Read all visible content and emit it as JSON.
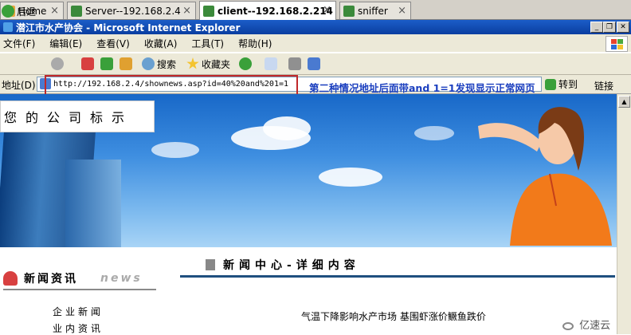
{
  "vm_tabs": [
    {
      "label": "Home",
      "active": false
    },
    {
      "label": "Server--192.168.2.4",
      "active": false
    },
    {
      "label": "client--192.168.2.214",
      "active": true
    },
    {
      "label": "sniffer",
      "active": false
    }
  ],
  "window": {
    "title": "潜江市水产协会 - Microsoft Internet Explorer"
  },
  "menu": [
    "文件(F)",
    "编辑(E)",
    "查看(V)",
    "收藏(A)",
    "工具(T)",
    "帮助(H)"
  ],
  "toolbar": {
    "back": "后退",
    "search": "搜索",
    "favorites": "收藏夹"
  },
  "address": {
    "label": "地址(D)",
    "url": "http://192.168.2.4/shownews.asp?id=40%20and%201=1",
    "go": "转到",
    "links": "链接"
  },
  "annotation": "第二种情况地址后面带and 1=1发现显示正常网页",
  "page": {
    "logo_text": "您的公司标示",
    "news_title": "新闻资讯",
    "news_en": "news",
    "side_items": [
      "企业新闻",
      "业内资讯"
    ],
    "detail_title": "新闻中心-详细内容",
    "headline": "气温下降影响水产市场 基围虾涨价鳜鱼跌价"
  },
  "watermark": "亿速云",
  "colors": {
    "ie_title": "#0a3ea0",
    "annotation": "#1b3fbf",
    "redbox": "#c0282a"
  }
}
